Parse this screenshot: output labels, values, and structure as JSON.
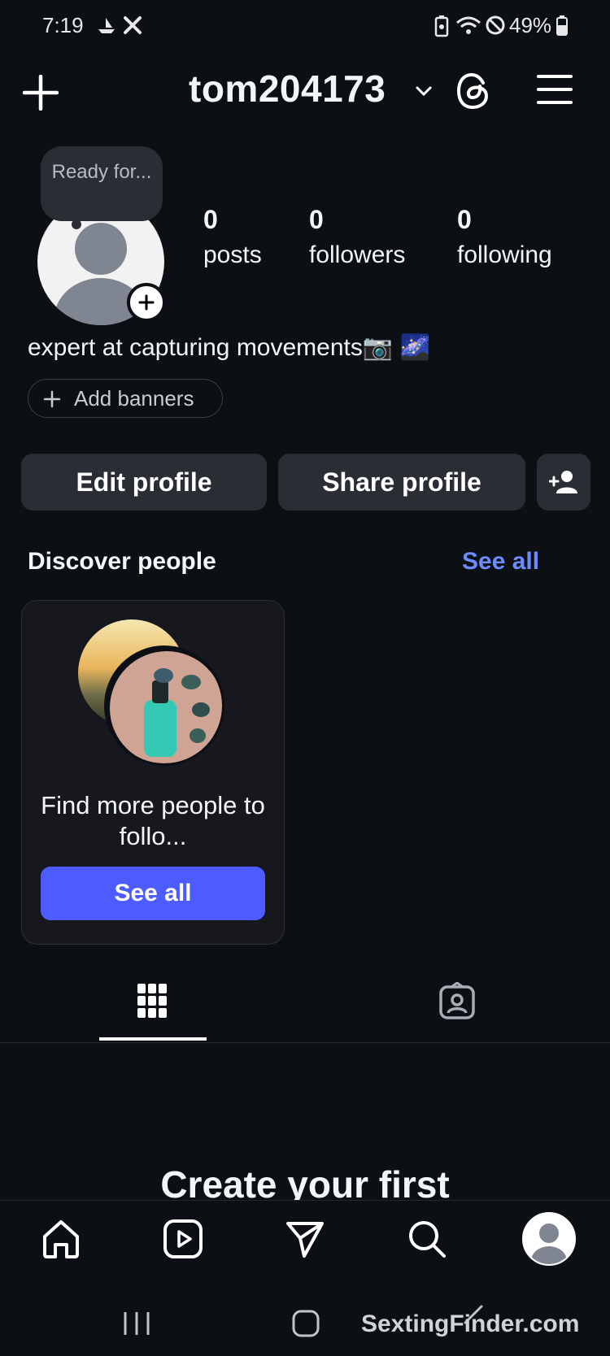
{
  "status_bar": {
    "time": "7:19",
    "battery": "49%"
  },
  "header": {
    "username": "tom204173",
    "icons": [
      "plus-icon",
      "chevron-down-icon",
      "threads-icon",
      "menu-icon"
    ]
  },
  "profile": {
    "note": "Ready for...",
    "stats": [
      {
        "value": "0",
        "label": "posts"
      },
      {
        "value": "0",
        "label": "followers"
      },
      {
        "value": "0",
        "label": "following"
      }
    ],
    "bio": "expert at capturing movements📷 🌌",
    "add_banners": "Add banners"
  },
  "actions": {
    "edit_profile": "Edit profile",
    "share_profile": "Share profile"
  },
  "discover": {
    "title": "Discover people",
    "see_all_link": "See all",
    "card_text": "Find more people to follo...",
    "card_button": "See all"
  },
  "tabs": [
    "grid-icon",
    "tagged-icon"
  ],
  "content": {
    "create_title": "Create your first"
  },
  "bottom_nav": [
    "home-icon",
    "reels-icon",
    "send-icon",
    "search-icon",
    "profile-avatar"
  ],
  "watermark": "SextingFinder.com",
  "colors": {
    "background": "#0c0f14",
    "button": "#2a2d34",
    "link": "#6b8cff",
    "primary_button": "#4d5cff"
  }
}
